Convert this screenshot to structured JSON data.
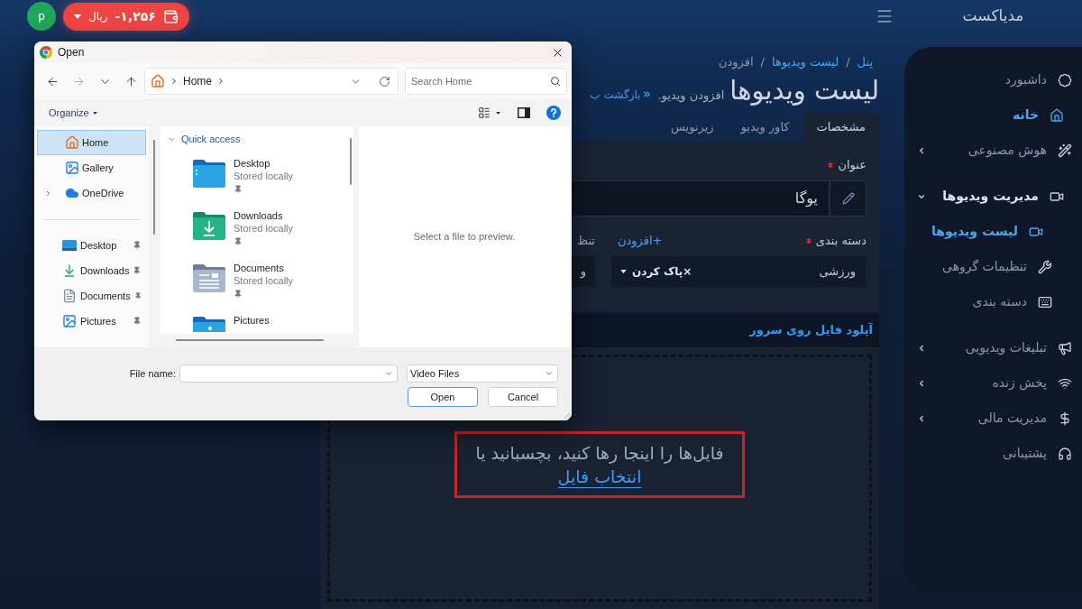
{
  "header": {
    "brand": "مدیاکست",
    "avatar_initial": "p",
    "wallet": {
      "amount": "-۱,۲۵۶",
      "currency": "ریال"
    }
  },
  "sidebar": {
    "items": [
      {
        "label": "داشبورد",
        "kind": "link",
        "selected": false
      },
      {
        "label": "خانه",
        "kind": "link",
        "selected": true
      },
      {
        "label": "هوش مصنوعی",
        "kind": "group",
        "selected": false,
        "expanded": false
      },
      {
        "label": "مدیریت ویدیوها",
        "kind": "group",
        "selected": false,
        "expanded": true,
        "children": [
          {
            "label": "لیست ویدیوها",
            "selected": true
          },
          {
            "label": "تنظیمات گروهی",
            "selected": false
          },
          {
            "label": "دسته بندی",
            "selected": false
          }
        ]
      },
      {
        "label": "تبلیغات ویدیویی",
        "kind": "group",
        "selected": false,
        "expanded": false
      },
      {
        "label": "پخش زنده",
        "kind": "group",
        "selected": false,
        "expanded": false
      },
      {
        "label": "مدیریت مالی",
        "kind": "group",
        "selected": false,
        "expanded": false
      },
      {
        "label": "پشتیبانی",
        "kind": "link",
        "selected": false
      }
    ]
  },
  "main": {
    "breadcrumb": [
      {
        "label": "پنل",
        "kind": "link"
      },
      {
        "label": "/",
        "kind": "separator"
      },
      {
        "label": "لیست ویدیوها",
        "kind": "link"
      },
      {
        "label": "/",
        "kind": "separator"
      },
      {
        "label": "افزودن",
        "kind": "current"
      }
    ],
    "title": "لیست ویدیوها",
    "subtitle": "افزودن ویدیو.",
    "back_link": "بازگشت ب",
    "tabs": [
      {
        "label": "مشخصات",
        "selected": true
      },
      {
        "label": "کاور ویدیو",
        "selected": false
      },
      {
        "label": "زیرنویس",
        "selected": false
      }
    ],
    "title_field": {
      "label": "عنوان",
      "required": true,
      "value": "یوگا"
    },
    "category_field": {
      "label": "دسته بندی",
      "required": true,
      "add_link": "+افزودن",
      "value": "ورزشی",
      "clear_label": "×پاک کردن"
    },
    "field_3": {
      "label": "تنظ",
      "value": "و"
    },
    "upload": {
      "title": "آپلود فایل روی سرور",
      "prompt": "فایل‌ها را اینجا رها کنید، بچسبانید یا",
      "link": "انتخاب فایل",
      "highlighted": true
    }
  },
  "dialog": {
    "title": "Open",
    "nav_buttons": [
      {
        "disabled": false
      },
      {
        "disabled": true
      },
      {
        "disabled": false
      },
      {
        "disabled": false
      }
    ],
    "address": "Home",
    "search_placeholder": "Search Home",
    "organize": "Organize",
    "nav_pane": {
      "locations": [
        {
          "label": "Home",
          "kind": "leaf",
          "selected": true
        },
        {
          "label": "Gallery",
          "kind": "leaf",
          "selected": false
        },
        {
          "label": "OneDrive",
          "kind": "tree",
          "selected": false,
          "expanded": false
        }
      ],
      "pinned": [
        {
          "label": "Desktop",
          "selected": false
        },
        {
          "label": "Downloads",
          "selected": false
        },
        {
          "label": "Documents",
          "selected": false
        },
        {
          "label": "Pictures",
          "selected": false
        }
      ]
    },
    "quick_access": {
      "title": "Quick access",
      "expanded": true,
      "items": [
        {
          "name": "Desktop",
          "status": "Stored locally",
          "selected": false
        },
        {
          "name": "Downloads",
          "status": "Stored locally",
          "selected": false
        },
        {
          "name": "Documents",
          "status": "Stored locally",
          "selected": false
        },
        {
          "name": "Pictures",
          "selected": false
        }
      ]
    },
    "preview_message": "Select a file to preview.",
    "file_name_label": "File name:",
    "file_type": "Video Files",
    "open_button": {
      "label": "Open",
      "default": true
    },
    "cancel_button": {
      "label": "Cancel",
      "default": false
    }
  }
}
